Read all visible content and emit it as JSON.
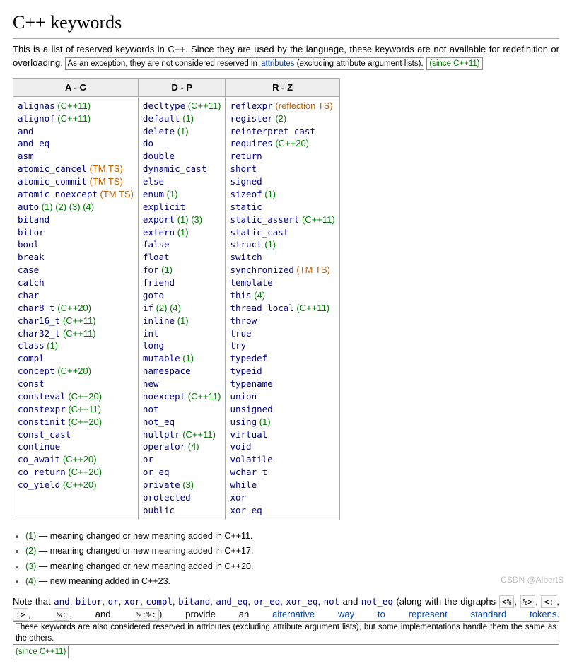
{
  "title": "C++ keywords",
  "intro": {
    "part1": "This is a list of reserved keywords in C++. Since they are used by the language, these keywords are not available for redefinition or overloading. ",
    "exception_prefix": "As an exception, they are not considered reserved in ",
    "attributes_link": "attributes",
    "exception_suffix": " (excluding attribute argument lists).",
    "since": "(since C++11)"
  },
  "columns": [
    {
      "header": "A - C",
      "items": [
        {
          "kw": "alignas",
          "note": "(C++11)",
          "cls": "g"
        },
        {
          "kw": "alignof",
          "note": "(C++11)",
          "cls": "g"
        },
        {
          "kw": "and"
        },
        {
          "kw": "and_eq"
        },
        {
          "kw": "asm"
        },
        {
          "kw": "atomic_cancel",
          "note": "(TM TS)",
          "cls": "o"
        },
        {
          "kw": "atomic_commit",
          "note": "(TM TS)",
          "cls": "o"
        },
        {
          "kw": "atomic_noexcept",
          "note": "(TM TS)",
          "cls": "o"
        },
        {
          "kw": "auto",
          "note": "(1) (2) (3) (4)",
          "cls": "g"
        },
        {
          "kw": "bitand"
        },
        {
          "kw": "bitor"
        },
        {
          "kw": "bool"
        },
        {
          "kw": "break"
        },
        {
          "kw": "case"
        },
        {
          "kw": "catch"
        },
        {
          "kw": "char"
        },
        {
          "kw": "char8_t",
          "note": "(C++20)",
          "cls": "g"
        },
        {
          "kw": "char16_t",
          "note": "(C++11)",
          "cls": "g"
        },
        {
          "kw": "char32_t",
          "note": "(C++11)",
          "cls": "g"
        },
        {
          "kw": "class",
          "note": "(1)",
          "cls": "g"
        },
        {
          "kw": "compl"
        },
        {
          "kw": "concept",
          "note": "(C++20)",
          "cls": "g"
        },
        {
          "kw": "const"
        },
        {
          "kw": "consteval",
          "note": "(C++20)",
          "cls": "g"
        },
        {
          "kw": "constexpr",
          "note": "(C++11)",
          "cls": "g"
        },
        {
          "kw": "constinit",
          "note": "(C++20)",
          "cls": "g"
        },
        {
          "kw": "const_cast"
        },
        {
          "kw": "continue"
        },
        {
          "kw": "co_await",
          "note": "(C++20)",
          "cls": "g"
        },
        {
          "kw": "co_return",
          "note": "(C++20)",
          "cls": "g"
        },
        {
          "kw": "co_yield",
          "note": "(C++20)",
          "cls": "g"
        }
      ]
    },
    {
      "header": "D - P",
      "items": [
        {
          "kw": "decltype",
          "note": "(C++11)",
          "cls": "g"
        },
        {
          "kw": "default",
          "note": "(1)",
          "cls": "g"
        },
        {
          "kw": "delete",
          "note": "(1)",
          "cls": "g"
        },
        {
          "kw": "do"
        },
        {
          "kw": "double"
        },
        {
          "kw": "dynamic_cast"
        },
        {
          "kw": "else"
        },
        {
          "kw": "enum",
          "note": "(1)",
          "cls": "g"
        },
        {
          "kw": "explicit"
        },
        {
          "kw": "export",
          "note": "(1) (3)",
          "cls": "g"
        },
        {
          "kw": "extern",
          "note": "(1)",
          "cls": "g"
        },
        {
          "kw": "false"
        },
        {
          "kw": "float"
        },
        {
          "kw": "for",
          "note": "(1)",
          "cls": "g"
        },
        {
          "kw": "friend"
        },
        {
          "kw": "goto"
        },
        {
          "kw": "if",
          "note": "(2) (4)",
          "cls": "g"
        },
        {
          "kw": "inline",
          "note": "(1)",
          "cls": "g"
        },
        {
          "kw": "int"
        },
        {
          "kw": "long"
        },
        {
          "kw": "mutable",
          "note": "(1)",
          "cls": "g"
        },
        {
          "kw": "namespace"
        },
        {
          "kw": "new"
        },
        {
          "kw": "noexcept",
          "note": "(C++11)",
          "cls": "g"
        },
        {
          "kw": "not"
        },
        {
          "kw": "not_eq"
        },
        {
          "kw": "nullptr",
          "note": "(C++11)",
          "cls": "g"
        },
        {
          "kw": "operator",
          "note": "(4)",
          "cls": "g"
        },
        {
          "kw": "or"
        },
        {
          "kw": "or_eq"
        },
        {
          "kw": "private",
          "note": "(3)",
          "cls": "g"
        },
        {
          "kw": "protected"
        },
        {
          "kw": "public"
        }
      ]
    },
    {
      "header": "R - Z",
      "items": [
        {
          "kw": "reflexpr",
          "note": "(reflection TS)",
          "cls": "o"
        },
        {
          "kw": "register",
          "note": "(2)",
          "cls": "g"
        },
        {
          "kw": "reinterpret_cast"
        },
        {
          "kw": "requires",
          "note": "(C++20)",
          "cls": "g"
        },
        {
          "kw": "return"
        },
        {
          "kw": "short"
        },
        {
          "kw": "signed"
        },
        {
          "kw": "sizeof",
          "note": "(1)",
          "cls": "g"
        },
        {
          "kw": "static"
        },
        {
          "kw": "static_assert",
          "note": "(C++11)",
          "cls": "g"
        },
        {
          "kw": "static_cast"
        },
        {
          "kw": "struct",
          "note": "(1)",
          "cls": "g"
        },
        {
          "kw": "switch"
        },
        {
          "kw": "synchronized",
          "note": "(TM TS)",
          "cls": "o"
        },
        {
          "kw": "template"
        },
        {
          "kw": "this",
          "note": "(4)",
          "cls": "g"
        },
        {
          "kw": "thread_local",
          "note": "(C++11)",
          "cls": "g"
        },
        {
          "kw": "throw"
        },
        {
          "kw": "true"
        },
        {
          "kw": "try"
        },
        {
          "kw": "typedef"
        },
        {
          "kw": "typeid"
        },
        {
          "kw": "typename"
        },
        {
          "kw": "union"
        },
        {
          "kw": "unsigned"
        },
        {
          "kw": "using",
          "note": "(1)",
          "cls": "g"
        },
        {
          "kw": "virtual"
        },
        {
          "kw": "void"
        },
        {
          "kw": "volatile"
        },
        {
          "kw": "wchar_t"
        },
        {
          "kw": "while"
        },
        {
          "kw": "xor"
        },
        {
          "kw": "xor_eq"
        }
      ]
    }
  ],
  "footnotes": [
    "(1) — meaning changed or new meaning added in C++11.",
    "(2) — meaning changed or new meaning added in C++17.",
    "(3) — meaning changed or new meaning added in C++20.",
    "(4) — new meaning added in C++23."
  ],
  "bottom": {
    "prefix": "Note that ",
    "alt_kws": [
      "and",
      "bitor",
      "or",
      "xor",
      "compl",
      "bitand",
      "and_eq",
      "or_eq",
      "xor_eq",
      "not",
      "not_eq"
    ],
    "digraphs_intro": " (along with the digraphs ",
    "digraphs": [
      "<%",
      "%>",
      "<:",
      ":>",
      "%:",
      "%:%:"
    ],
    "digraphs_close": ") provide an ",
    "alt_link": "alternative way to represent standard tokens",
    "after_alt": ". ",
    "boxed_prefix": "These keywords are also considered reserved in attributes (excluding attribute argument lists), but some implementations handle them the same as the others.",
    "since": "(since C++11)"
  },
  "watermark": "CSDN @AlbertS"
}
